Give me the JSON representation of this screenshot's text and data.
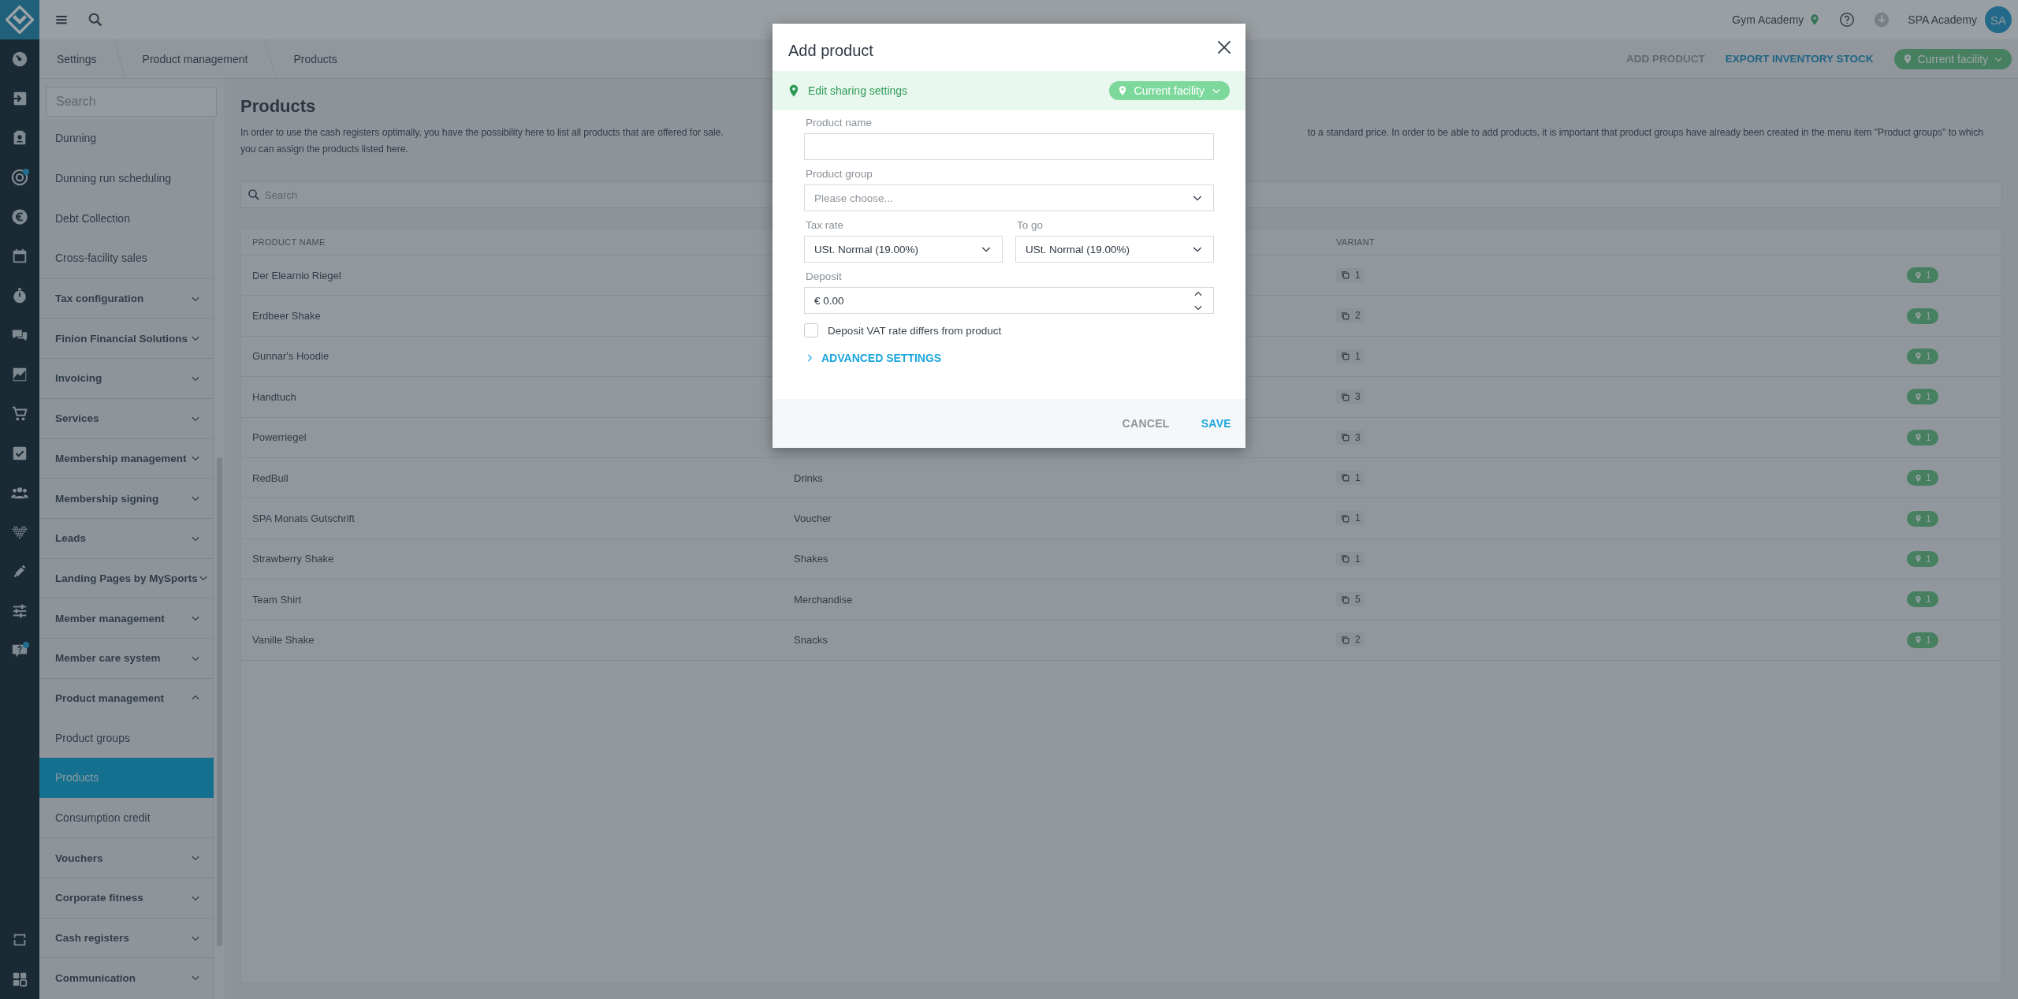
{
  "rail": {
    "items": [
      {
        "notification": false
      },
      {
        "notification": false
      },
      {
        "notification": false
      },
      {
        "notification": true
      },
      {
        "notification": false
      },
      {
        "notification": false
      },
      {
        "notification": false
      },
      {
        "notification": false
      },
      {
        "notification": false
      },
      {
        "notification": false
      },
      {
        "notification": false
      },
      {
        "notification": false
      },
      {
        "notification": false
      },
      {
        "notification": false
      },
      {
        "notification": false
      },
      {
        "notification": true
      }
    ],
    "bottom_items": [
      {
        "notification": false
      },
      {
        "notification": false
      }
    ]
  },
  "topbar": {
    "facility": "Gym Academy",
    "user": "SPA Academy",
    "avatar": "SA"
  },
  "breadcrumbs": [
    "Settings",
    "Product management",
    "Products"
  ],
  "actions": [
    {
      "kind": "link",
      "label": "ADD PRODUCT",
      "disabled": true
    },
    {
      "kind": "link",
      "label": "EXPORT INVENTORY STOCK",
      "disabled": false
    },
    {
      "kind": "facility",
      "label": "Current facility"
    }
  ],
  "sidebar": {
    "search": {
      "placeholder": "Search"
    },
    "items": [
      {
        "kind": "link",
        "label": "Dunning",
        "selected": false
      },
      {
        "kind": "link",
        "label": "Dunning run scheduling",
        "selected": false
      },
      {
        "kind": "link",
        "label": "Debt Collection",
        "selected": false
      },
      {
        "kind": "link",
        "label": "Cross-facility sales",
        "selected": false
      },
      {
        "kind": "group",
        "label": "Tax configuration",
        "expanded": false
      },
      {
        "kind": "group",
        "label": "Finion Financial Solutions",
        "expanded": false
      },
      {
        "kind": "group",
        "label": "Invoicing",
        "expanded": false
      },
      {
        "kind": "group",
        "label": "Services",
        "expanded": false
      },
      {
        "kind": "group",
        "label": "Membership management",
        "expanded": false
      },
      {
        "kind": "group",
        "label": "Membership signing",
        "expanded": false
      },
      {
        "kind": "group",
        "label": "Leads",
        "expanded": false
      },
      {
        "kind": "group",
        "label": "Landing Pages by MySports",
        "expanded": false
      },
      {
        "kind": "group",
        "label": "Member management",
        "expanded": false
      },
      {
        "kind": "group",
        "label": "Member care system",
        "expanded": false
      },
      {
        "kind": "group",
        "label": "Product management",
        "expanded": true,
        "children": [
          {
            "label": "Product groups",
            "selected": false
          },
          {
            "label": "Products",
            "selected": true
          },
          {
            "label": "Consumption credit",
            "selected": false
          }
        ]
      },
      {
        "kind": "group",
        "label": "Vouchers",
        "expanded": false
      },
      {
        "kind": "group",
        "label": "Corporate fitness",
        "expanded": false
      },
      {
        "kind": "group",
        "label": "Cash registers",
        "expanded": false
      },
      {
        "kind": "group",
        "label": "Communication",
        "expanded": false
      }
    ]
  },
  "page": {
    "title": "Products",
    "description": {
      "line_1_start": "In order to use the cash registers optimally, you have the possibility here to list all products that are offered for sale.",
      "line_1_end": "to a standard price. In order to be able to add products, it is important that product groups have already been created in the menu item \"Product groups\" to which",
      "line_2": "you can assign the products listed here."
    }
  },
  "search": {
    "placeholder": "Search"
  },
  "table": {
    "columns": {
      "product_name": "PRODUCT NAME",
      "variant": "VARIANT"
    },
    "rows": [
      {
        "name": "Der Elearnio Riegel",
        "variants": "1",
        "facilities": "1"
      },
      {
        "name": "Erdbeer Shake",
        "variants": "2",
        "facilities": "1"
      },
      {
        "name": "Gunnar's Hoodie",
        "variants": "1",
        "facilities": "1"
      },
      {
        "name": "Handtuch",
        "variants": "3",
        "facilities": "1"
      },
      {
        "name": "Powerriegel",
        "variants": "3",
        "facilities": "1"
      },
      {
        "name": "RedBull",
        "group": "Drinks",
        "variants": "1",
        "facilities": "1"
      },
      {
        "name": "SPA Monats Gutschrift",
        "group": "Voucher",
        "variants": "1",
        "facilities": "1"
      },
      {
        "name": "Strawberry Shake",
        "group": "Shakes",
        "variants": "1",
        "facilities": "1"
      },
      {
        "name": "Team Shirt",
        "group": "Merchandise",
        "variants": "5",
        "facilities": "1"
      },
      {
        "name": "Vanille Shake",
        "group": "Snacks",
        "variants": "2",
        "facilities": "1"
      }
    ]
  },
  "modal": {
    "title": "Add product",
    "sharing": {
      "label": "Edit sharing settings",
      "scope": "Current facility"
    },
    "rows": [
      [
        {
          "kind": "text",
          "label": "Product name"
        }
      ],
      [
        {
          "kind": "select",
          "label": "Product group",
          "placeholder": "Please choose..."
        }
      ],
      [
        {
          "kind": "select",
          "label": "Tax rate",
          "value": "USt. Normal (19.00%)"
        },
        {
          "kind": "select",
          "label": "To go",
          "value": "USt. Normal (19.00%)"
        }
      ],
      [
        {
          "kind": "number",
          "label": "Deposit",
          "value": "€ 0.00"
        }
      ]
    ],
    "checkbox": {
      "label": "Deposit VAT rate differs from product",
      "checked": false
    },
    "advanced": {
      "label": "ADVANCED SETTINGS",
      "expanded": false
    },
    "buttons": [
      {
        "kind": "secondary",
        "label": "CANCEL"
      },
      {
        "kind": "primary",
        "label": "SAVE"
      }
    ]
  }
}
